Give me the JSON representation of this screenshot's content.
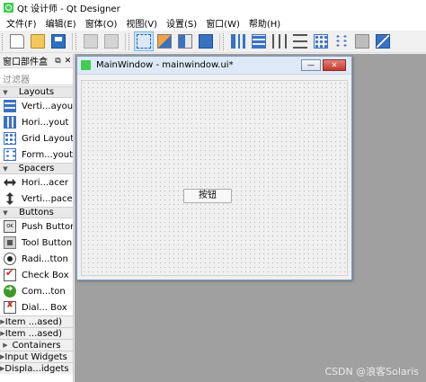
{
  "app": {
    "title": "Qt 设计师 - Qt Designer"
  },
  "menubar": {
    "items": [
      "文件(F)",
      "编辑(E)",
      "窗体(O)",
      "视图(V)",
      "设置(S)",
      "窗口(W)",
      "帮助(H)"
    ]
  },
  "toolbar": {
    "groups": [
      [
        "new-form-icon",
        "open-form-icon",
        "save-form-icon"
      ],
      [
        "copy-icon",
        "paste-icon"
      ],
      [
        "edit-widgets-icon",
        "edit-signals-slots-icon",
        "edit-buddies-icon",
        "edit-tab-order-icon"
      ],
      [
        "lay-out-horizontally-icon",
        "lay-out-vertically-icon",
        "splitter-horizontal-icon",
        "splitter-vertical-icon",
        "lay-out-grid-icon",
        "lay-out-form-icon",
        "break-layout-icon",
        "adjust-size-icon"
      ]
    ],
    "active": "edit-widgets-icon"
  },
  "widgetbox": {
    "title": "窗口部件盒",
    "dock_float": "⧉",
    "dock_close": "✕",
    "filter_placeholder": "过滤器",
    "categories": [
      {
        "label": "Layouts",
        "items": [
          {
            "label": "Verti...ayout",
            "icon": "vertical-layout-icon"
          },
          {
            "label": "Hori...yout",
            "icon": "horizontal-layout-icon"
          },
          {
            "label": "Grid Layout",
            "icon": "grid-layout-icon"
          },
          {
            "label": "Form...yout",
            "icon": "form-layout-icon"
          }
        ]
      },
      {
        "label": "Spacers",
        "items": [
          {
            "label": "Hori...acer",
            "icon": "horizontal-spacer-icon"
          },
          {
            "label": "Verti...pacer",
            "icon": "vertical-spacer-icon"
          }
        ]
      },
      {
        "label": "Buttons",
        "items": [
          {
            "label": "Push Button",
            "icon": "push-button-icon"
          },
          {
            "label": "Tool Button",
            "icon": "tool-button-icon"
          },
          {
            "label": "Radi...tton",
            "icon": "radio-button-icon"
          },
          {
            "label": "Check Box",
            "icon": "check-box-icon"
          },
          {
            "label": "Com...ton",
            "icon": "command-link-button-icon"
          },
          {
            "label": "Dial... Box",
            "icon": "dialog-button-box-icon"
          }
        ]
      }
    ],
    "collapsed": [
      "Item ...ased)",
      "Item ...ased)",
      "Containers",
      "Input Widgets",
      "Displa...idgets"
    ]
  },
  "mainwindow": {
    "title": "MainWindow - mainwindow.ui*",
    "button_label": "按钮",
    "minimize_glyph": "—",
    "close_glyph": "✕"
  },
  "watermark": "CSDN @浪客Solaris"
}
